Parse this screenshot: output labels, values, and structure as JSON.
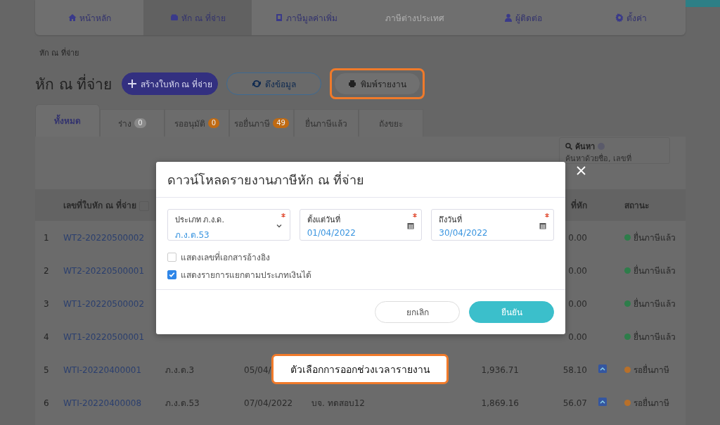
{
  "nav": {
    "items": [
      {
        "label": "หน้าหลัก",
        "selected": false,
        "disabled": false
      },
      {
        "label": "หัก ณ ที่จ่าย",
        "selected": true,
        "disabled": false
      },
      {
        "label": "ภาษีมูลค่าเพิ่ม",
        "selected": false,
        "disabled": false
      },
      {
        "label": "ภาษีต่างประเทศ",
        "selected": false,
        "disabled": true
      },
      {
        "label": "ผู้ติดต่อ",
        "selected": false,
        "disabled": false
      },
      {
        "label": "ตั้งค่า",
        "selected": false,
        "disabled": false
      }
    ]
  },
  "breadcrumb": "หัก ณ ที่จ่าย",
  "heading": "หัก ณ ที่จ่าย",
  "actions": [
    {
      "label": "สร้างใบหัก ณ ที่จ่าย",
      "kind": "primary",
      "highlighted": false
    },
    {
      "label": "ดึงข้อมูล",
      "kind": "outline",
      "highlighted": false
    },
    {
      "label": "พิมพ์รายงาน",
      "kind": "plain",
      "highlighted": true
    }
  ],
  "status_tabs": [
    {
      "label": "ทั้งหมด",
      "selected": true
    },
    {
      "label": "ร่าง",
      "count": "0",
      "color": "#8a8a8a",
      "selected": false
    },
    {
      "label": "รออนุมัติ",
      "count": "0",
      "color": "#c06a12",
      "selected": false
    },
    {
      "label": "รอยื่นภาษี",
      "count": "49",
      "color": "#c06a12",
      "selected": false
    },
    {
      "label": "ยื่นภาษีแล้ว",
      "selected": false
    },
    {
      "label": "ถังขยะ",
      "selected": false
    }
  ],
  "search": {
    "label": "ค้นหา",
    "placeholder": "ค้นหาด้วยชื่อ, เลขที่"
  },
  "table": {
    "columns": [
      "เลขที่ใบหัก ณ ที่จ่าย",
      "ที่หัก",
      "สถานะ"
    ],
    "rows": [
      {
        "number": "1",
        "doc_no": "WT2-20220500002",
        "tax": "0.00",
        "attachment": false,
        "status": {
          "label": "ยื่นภาษีแล้ว",
          "color": "#2e7d4a"
        }
      },
      {
        "number": "2",
        "doc_no": "WT2-20220500001",
        "tax": "0.00",
        "attachment": false,
        "status": {
          "label": "ยื่นภาษีแล้ว",
          "color": "#2e7d4a"
        }
      },
      {
        "number": "3",
        "doc_no": "WT1-20220500002",
        "tax": "0.00",
        "attachment": false,
        "status": {
          "label": "ยื่นภาษีแล้ว",
          "color": "#2e7d4a"
        }
      },
      {
        "number": "4",
        "doc_no": "WT1-20220500001",
        "tax": "0.00",
        "attachment": false,
        "status": {
          "label": "ยื่นภาษีแล้ว",
          "color": "#2e7d4a"
        }
      },
      {
        "number": "5",
        "doc_no": "WTI-20220400001",
        "type": "ภ.ง.ด.3",
        "date": "05/04/",
        "amount": "1,936.71",
        "tax": "58.10",
        "attachment": true,
        "status": {
          "label": "รอยื่นภาษี",
          "color": "#b8702a"
        }
      },
      {
        "number": "6",
        "doc_no": "WTI-20220400008",
        "type": "ภ.ง.ด.53",
        "date": "07/04/2022",
        "name": "บจ. ทดสอบ12",
        "amount": "1,869.16",
        "tax": "56.07",
        "attachment": true,
        "status": {
          "label": "รอยื่นภาษี",
          "color": "#b8702a"
        }
      }
    ]
  },
  "modal": {
    "title": "ดาวน์โหลดรายงานภาษีหัก ณ ที่จ่าย",
    "fields": [
      {
        "label": "ประเภท ภ.ง.ด.",
        "value": "ภ.ง.ด.53",
        "kind": "select",
        "required": true
      },
      {
        "label": "ตั้งแต่วันที่",
        "value": "01/04/2022",
        "kind": "date",
        "required": true
      },
      {
        "label": "ถึงวันที่",
        "value": "30/04/2022",
        "kind": "date",
        "required": true
      }
    ],
    "checkboxes": [
      {
        "label": "แสดงเลขที่เอกสารอ้างอิง",
        "checked": false
      },
      {
        "label": "แสดงรายการแยกตามประเภทเงินได้",
        "checked": true
      }
    ],
    "buttons": [
      {
        "label": "ยกเลิก",
        "kind": "secondary"
      },
      {
        "label": "ยืนยัน",
        "kind": "primary"
      }
    ]
  },
  "callout": "ตัวเลือกการออกช่วงเวลารายงาน"
}
